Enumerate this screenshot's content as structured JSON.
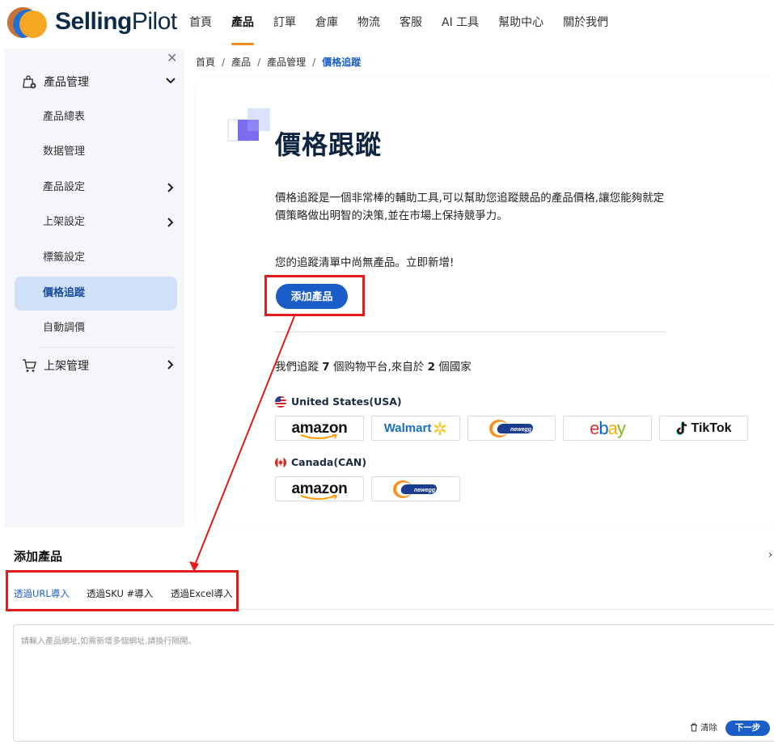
{
  "brand": {
    "name_bold": "Selling",
    "name_light": "Pilot"
  },
  "nav": {
    "items": [
      {
        "label": "首頁"
      },
      {
        "label": "產品"
      },
      {
        "label": "訂單"
      },
      {
        "label": "倉庫"
      },
      {
        "label": "物流"
      },
      {
        "label": "客服"
      },
      {
        "label": "AI 工具"
      },
      {
        "label": "幫助中心"
      },
      {
        "label": "關於我們"
      }
    ],
    "active_index": 1
  },
  "sidebar": {
    "close_symbol": "✕",
    "group_product": "產品管理",
    "items": [
      {
        "label": "產品總表"
      },
      {
        "label": "数据管理"
      },
      {
        "label": "產品設定"
      },
      {
        "label": "上架設定"
      },
      {
        "label": "標籤設定"
      },
      {
        "label": "價格追蹤"
      },
      {
        "label": "自動調價"
      }
    ],
    "group_listing": "上架管理"
  },
  "breadcrumb": {
    "items": [
      "首頁",
      "產品",
      "產品管理",
      "價格追蹤"
    ],
    "separator": "/"
  },
  "main": {
    "title": "價格跟蹤",
    "description": "價格追蹤是一個非常棒的輔助工具,可以幫助您追蹤競品的產品價格,讓您能夠就定價策略做出明智的決策,並在市場上保持競爭力。",
    "empty_note": "您的追蹤清單中尚無產品。立即新增!",
    "add_button": "添加產品",
    "summary_prefix": "我們追蹤",
    "summary_platforms": "7",
    "summary_middle": "個购物平台,來自於",
    "summary_countries": "2",
    "summary_suffix": "個國家"
  },
  "regions": [
    {
      "name": "United States(USA)",
      "marketplaces": [
        "amazon",
        "Walmart",
        "newegg",
        "ebay",
        "TikTok"
      ]
    },
    {
      "name": "Canada(CAN)",
      "marketplaces": [
        "amazon",
        "newegg"
      ]
    }
  ],
  "add_panel": {
    "title": "添加產品",
    "close_symbol": "›",
    "tabs": [
      {
        "label": "透過URL導入"
      },
      {
        "label": "透過SKU #導入"
      },
      {
        "label": "透過Excel導入"
      }
    ],
    "active_tab": 0,
    "url_placeholder": "請輸入產品網址,如需新增多個網址,請換行隔開。",
    "clear_label": "清除",
    "next_label": "下一步"
  },
  "colors": {
    "accent_blue": "#1a5cc8",
    "nav_active_underline": "#f28c1e",
    "highlight_red": "#e31b1b",
    "sidebar_active_bg": "#cfe0f7",
    "ebay_e": "#e53238",
    "ebay_b": "#0064d2",
    "ebay_a": "#f5af02",
    "ebay_y": "#86b817"
  },
  "icons": {
    "logo": "sellingpilot-logo-icon",
    "product_group": "product-bag-icon",
    "listing_group": "shopping-cart-icon",
    "hero": "price-tracking-squares-icon",
    "usa_flag": "usa-flag-icon",
    "canada_flag": "canada-flag-icon",
    "trash": "trash-icon"
  }
}
